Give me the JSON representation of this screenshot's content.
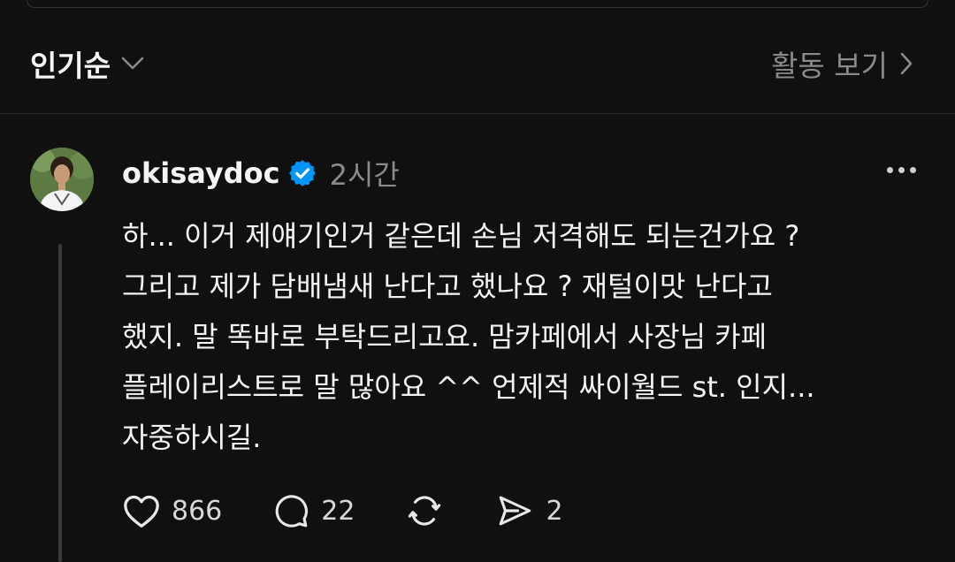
{
  "sort_bar": {
    "sort_label": "인기순",
    "activity_label": "활동 보기"
  },
  "post": {
    "username": "okisaydoc",
    "time": "2시간",
    "text": "하... 이거 제얘기인거 같은데 손님 저격해도 되는건가요 ?\n그리고 제가 담배냄새 난다고 했나요 ? 재털이맛 난다고\n했지. 말 똑바로 부탁드리고요. 맘카페에서 사장님 카페\n플레이리스트로 말 많아요 ^^ 언제적 싸이월드 st. 인지...\n자중하시길.",
    "likes": "866",
    "replies": "22",
    "shares": "2"
  },
  "colors": {
    "background": "#101010",
    "verified_badge": "#0095f6",
    "muted_text": "#8a8a8a"
  }
}
